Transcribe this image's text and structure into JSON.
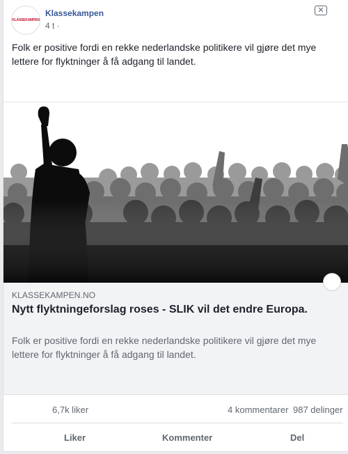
{
  "post": {
    "page_name": "Klassekampen",
    "avatar_text": "KLASSEKAMPEN",
    "time": "4 t",
    "time_separator": "·",
    "close_glyph": "✕",
    "text": "Folk er positive fordi en rekke nederlandske politikere vil gjøre det mye lettere for flyktninger å få adgang til landet."
  },
  "link_preview": {
    "image": "crowd-silhouette-raised-fist",
    "domain": "KLASSEKAMPEN.NO",
    "title": "Nytt flyktningeforslag roses - SLIK vil det endre Europa.",
    "description": "Folk er positive fordi en rekke nederlandske politikere vil gjøre det mye lettere for flyktninger å få adgang til landet."
  },
  "stats": {
    "likes": "6,7k liker",
    "comments": "4 kommentarer",
    "shares": "987 delinger"
  },
  "actions": {
    "like": "Liker",
    "comment": "Kommenter",
    "share": "Del"
  },
  "colors": {
    "page_name": "#385898",
    "secondary_text": "#606770",
    "link_box_bg": "#f2f3f5"
  }
}
